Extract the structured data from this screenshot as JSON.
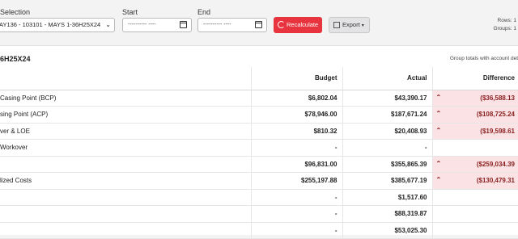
{
  "toolbar": {
    "selection_label": "Selection",
    "selection_value": "AY136 - 103101 - MAYS 1-36H25X24",
    "start_label": "Start",
    "start_placeholder": "---------- ----",
    "end_label": "End",
    "end_placeholder": "---------- ----",
    "recalculate_label": "Recalculate",
    "export_label": "Export",
    "rows_text": "Rows: 1",
    "groups_text": "Groups: 1",
    "accent_color": "#e8343f"
  },
  "group": {
    "title": "6H25X24",
    "note": "Group totals with account det"
  },
  "table": {
    "headers": {
      "budget": "Budget",
      "actual": "Actual",
      "difference": "Difference"
    },
    "rows": [
      {
        "label": "Casing Point (BCP)",
        "budget": "$6,802.04",
        "actual": "$43,390.17",
        "diff": "($36,588.13",
        "diff_negative": true
      },
      {
        "label": "sing Point (ACP)",
        "budget": "$78,946.00",
        "actual": "$187,671.24",
        "diff": "($108,725.24",
        "diff_negative": true
      },
      {
        "label": "ver & LOE",
        "budget": "$810.32",
        "actual": "$20,408.93",
        "diff": "($19,598.61",
        "diff_negative": true
      },
      {
        "label": " Workover",
        "budget": "-",
        "actual": "-",
        "diff": "",
        "diff_negative": false
      },
      {
        "label": "",
        "budget": "$96,831.00",
        "actual": "$355,865.39",
        "diff": "($259,034.39",
        "diff_negative": true
      },
      {
        "label": "lized Costs",
        "budget": "$255,197.88",
        "actual": "$385,677.19",
        "diff": "($130,479.31",
        "diff_negative": true
      },
      {
        "label": "",
        "budget": "-",
        "actual": "$1,517.60",
        "diff": "",
        "diff_negative": false
      },
      {
        "label": "",
        "budget": "-",
        "actual": "$88,319.87",
        "diff": "",
        "diff_negative": false
      },
      {
        "label": "",
        "budget": "-",
        "actual": "$53,025.30",
        "diff": "",
        "diff_negative": false
      }
    ]
  }
}
